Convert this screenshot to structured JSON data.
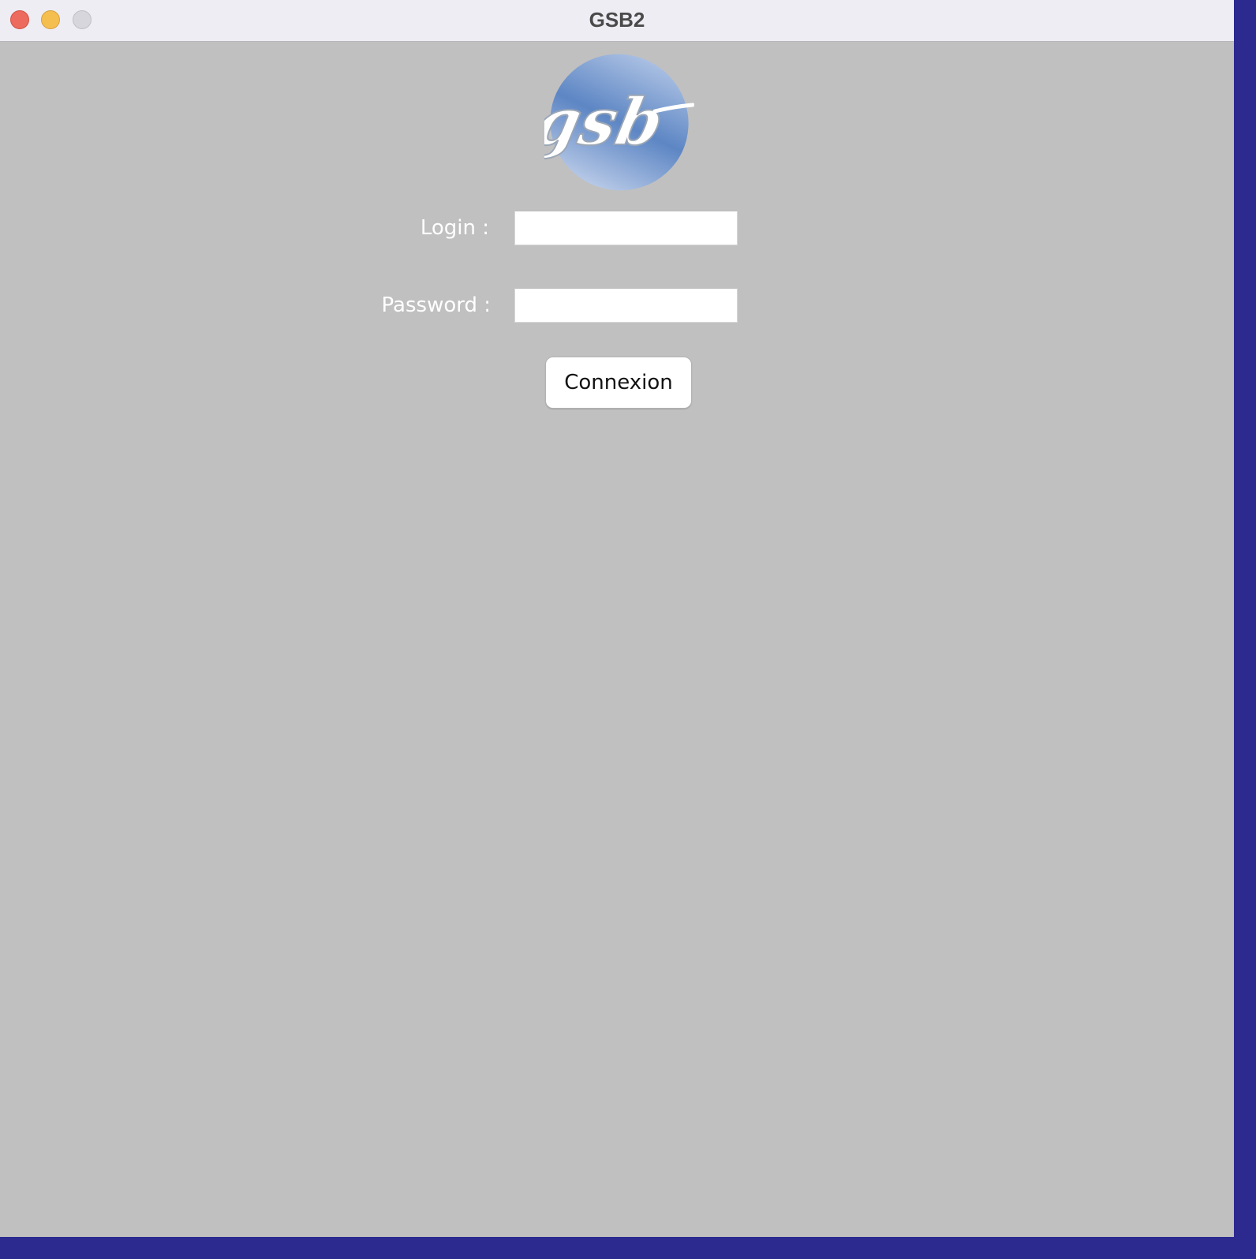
{
  "window": {
    "title": "GSB2"
  },
  "logo": {
    "text": "gsb",
    "icon": "gsb-logo"
  },
  "form": {
    "login_label": "Login :",
    "login_value": "",
    "password_label": "Password :",
    "password_value": "",
    "submit_label": "Connexion"
  },
  "colors": {
    "background": "#c0c0c0",
    "titlebar": "#eeedf4",
    "logo_blue": "#5f86c2",
    "close": "#ed6a5e",
    "minimize": "#f5bf4f",
    "zoom": "#d7d6dc"
  }
}
